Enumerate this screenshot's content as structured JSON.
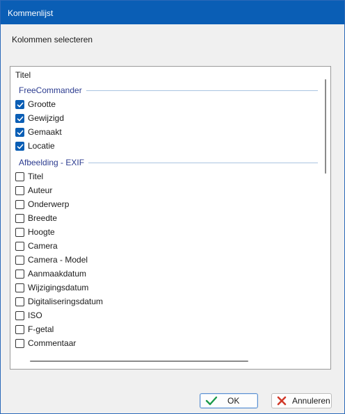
{
  "window": {
    "title": "Kommenlijst"
  },
  "header": {
    "subtitle": "Kolommen selecteren"
  },
  "list": {
    "top_item": "Titel",
    "groups": [
      {
        "name": "FreeCommander",
        "items": [
          {
            "label": "Grootte",
            "checked": true
          },
          {
            "label": "Gewijzigd",
            "checked": true
          },
          {
            "label": "Gemaakt",
            "checked": true
          },
          {
            "label": "Locatie",
            "checked": true
          }
        ]
      },
      {
        "name": "Afbeelding - EXIF",
        "items": [
          {
            "label": "Titel",
            "checked": false
          },
          {
            "label": "Auteur",
            "checked": false
          },
          {
            "label": "Onderwerp",
            "checked": false
          },
          {
            "label": "Breedte",
            "checked": false
          },
          {
            "label": "Hoogte",
            "checked": false
          },
          {
            "label": "Camera",
            "checked": false
          },
          {
            "label": "Camera - Model",
            "checked": false
          },
          {
            "label": "Aanmaakdatum",
            "checked": false
          },
          {
            "label": "Wijzigingsdatum",
            "checked": false
          },
          {
            "label": "Digitaliseringsdatum",
            "checked": false
          },
          {
            "label": "ISO",
            "checked": false
          },
          {
            "label": "F-getal",
            "checked": false
          },
          {
            "label": "Commentaar",
            "checked": false
          }
        ]
      }
    ]
  },
  "footer": {
    "ok_label": "OK",
    "cancel_label": "Annuleren"
  },
  "colors": {
    "titlebar": "#0a5eb5",
    "checked": "#0a5eb5",
    "group_text": "#2b3b8f",
    "ok_icon": "#1a9a4a",
    "cancel_icon": "#d13a2a"
  },
  "icons": {
    "ok": "checkmark-icon",
    "cancel": "x-icon"
  }
}
